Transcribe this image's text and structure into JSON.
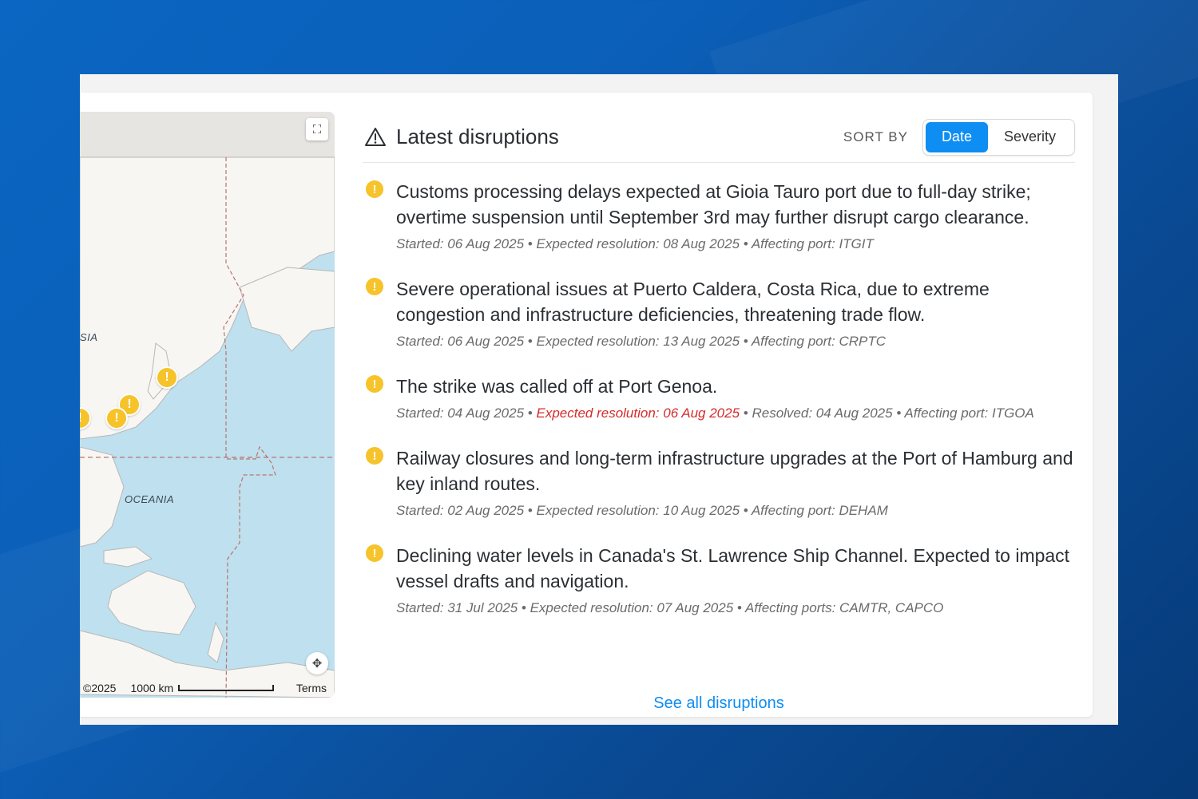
{
  "map": {
    "labels": {
      "asia": "SIA",
      "oceania": "OCEANIA"
    },
    "attribution": "©2025",
    "scale": "1000 km",
    "terms": "Terms",
    "icons": {
      "fullscreen": "fullscreen-icon",
      "recenter": "recenter-icon",
      "marker": "alert-marker-icon"
    },
    "marker_glyph": "!"
  },
  "header": {
    "title": "Latest disruptions",
    "sort_by": "SORT BY",
    "sort_options": [
      "Date",
      "Severity"
    ],
    "active_sort": "Date"
  },
  "disruptions": [
    {
      "title": "Customs processing delays expected at Gioia Tauro port due to full-day strike; overtime suspension until September 3rd may further disrupt cargo clearance.",
      "started": "Started: 06 Aug 2025",
      "expected": "Expected resolution: 08 Aug 2025",
      "port": "Affecting port: ITGIT"
    },
    {
      "title": "Severe operational issues at Puerto Caldera, Costa Rica, due to extreme congestion and infrastructure deficiencies, threatening trade flow.",
      "started": "Started: 06 Aug 2025",
      "expected": "Expected resolution: 13 Aug 2025",
      "port": "Affecting port: CRPTC"
    },
    {
      "title": "The strike was called off at Port Genoa.",
      "started": "Started: 04 Aug 2025",
      "expected": "Expected resolution: 06 Aug 2025",
      "resolved": "Resolved: 04 Aug 2025",
      "port": "Affecting port: ITGOA"
    },
    {
      "title": "Railway closures and long-term infrastructure upgrades at the Port of Hamburg and key inland routes.",
      "started": "Started: 02 Aug 2025",
      "expected": "Expected resolution: 10 Aug 2025",
      "port": "Affecting port: DEHAM"
    },
    {
      "title": "Declining water levels in Canada's St. Lawrence Ship Channel. Expected to impact vessel drafts and navigation.",
      "started": "Started: 31 Jul 2025",
      "expected": "Expected resolution: 07 Aug 2025",
      "port": "Affecting ports: CAMTR, CAPCO"
    }
  ],
  "separator": "•",
  "see_all": "See all disruptions",
  "colors": {
    "accent": "#0e8df2",
    "warning": "#f6c32a",
    "overdue": "#d62b2b"
  }
}
